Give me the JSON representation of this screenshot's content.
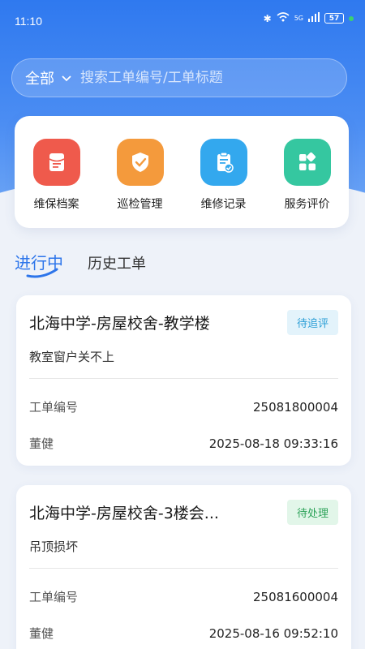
{
  "status_bar": {
    "time": "11:10",
    "signal_label": "5G",
    "battery": "57"
  },
  "search": {
    "scope": "全部",
    "placeholder": "搜索工单编号/工单标题"
  },
  "quick_actions": [
    {
      "label": "维保档案",
      "icon": "archive-icon",
      "color": "#ef5a4c"
    },
    {
      "label": "巡检管理",
      "icon": "shield-check-icon",
      "color": "#f49a3c"
    },
    {
      "label": "维修记录",
      "icon": "clipboard-icon",
      "color": "#33a8ee"
    },
    {
      "label": "服务评价",
      "icon": "grid-apps-icon",
      "color": "#35c7a0"
    }
  ],
  "tabs": [
    {
      "label": "进行中",
      "active": true
    },
    {
      "label": "历史工单",
      "active": false
    }
  ],
  "orders": [
    {
      "title": "北海中学-房屋校舍-教学楼",
      "status": "待追评",
      "description": "教室窗户关不上",
      "number_label": "工单编号",
      "number": "25081800004",
      "person": "董健",
      "datetime": "2025-08-18 09:33:16"
    },
    {
      "title": "北海中学-房屋校舍-3楼会...",
      "status": "待处理",
      "description": "吊顶损坏",
      "number_label": "工单编号",
      "number": "25081600004",
      "person": "董健",
      "datetime": "2025-08-16 09:52:10"
    }
  ],
  "colors": {
    "primary": "#2f79ef",
    "badge_blue": "#2a9ed6",
    "badge_green": "#2ea35a"
  }
}
